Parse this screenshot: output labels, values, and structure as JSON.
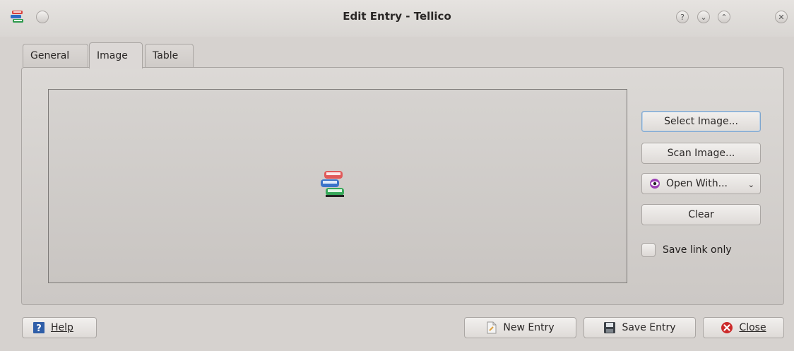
{
  "window": {
    "title": "Edit Entry - Tellico",
    "help_glyph": "?",
    "minimize_glyph": "⌄",
    "maximize_glyph": "⌃",
    "close_glyph": "✕"
  },
  "tabs": [
    {
      "label": "General",
      "active": false
    },
    {
      "label": "Image",
      "active": true
    },
    {
      "label": "Table",
      "active": false
    }
  ],
  "image_panel": {
    "select_image": "Select Image...",
    "scan_image": "Scan Image...",
    "open_with": "Open With...",
    "clear": "Clear",
    "save_link_only": "Save link only"
  },
  "bottom": {
    "help": "Help",
    "new_entry": "New Entry",
    "save_entry": "Save Entry",
    "close": "Close"
  },
  "icons": {
    "app": "books-icon",
    "placeholder": "books-icon",
    "help": "help-book-icon",
    "new_entry": "new-document-icon",
    "save": "floppy-disk-icon",
    "close": "close-circle-icon",
    "open_with": "eye-icon"
  },
  "colors": {
    "window_bg": "#d6d2cf",
    "focus_border": "#7ea6cf",
    "close_red": "#cc2a2a"
  }
}
